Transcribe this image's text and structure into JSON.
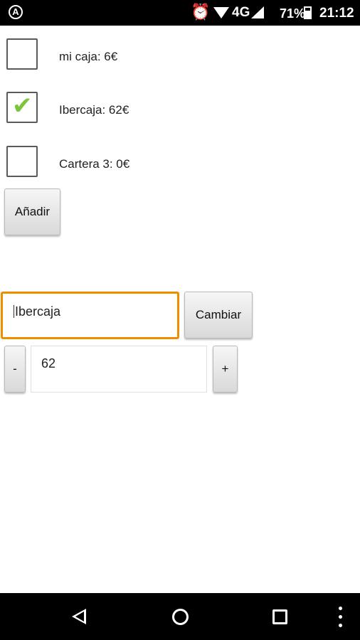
{
  "status_bar": {
    "network": "4G",
    "battery": "71%",
    "time": "21:12",
    "icons": [
      "app-icon",
      "alarm-icon",
      "wifi-icon",
      "signal-icon",
      "battery-icon"
    ]
  },
  "wallets": [
    {
      "label": "mi caja: 6€",
      "checked": false
    },
    {
      "label": "Ibercaja: 62€",
      "checked": true
    },
    {
      "label": "Cartera 3: 0€",
      "checked": false
    }
  ],
  "add_button": "Añadir",
  "editor": {
    "name_value": "Ibercaja",
    "change_button": "Cambiar",
    "minus_button": "-",
    "amount_value": "62",
    "plus_button": "+"
  },
  "nav_bar": {
    "icons": [
      "back-icon",
      "home-icon",
      "recents-icon",
      "more-icon"
    ]
  },
  "colors": {
    "accent": "#f08c00",
    "check": "#7cc53a"
  }
}
